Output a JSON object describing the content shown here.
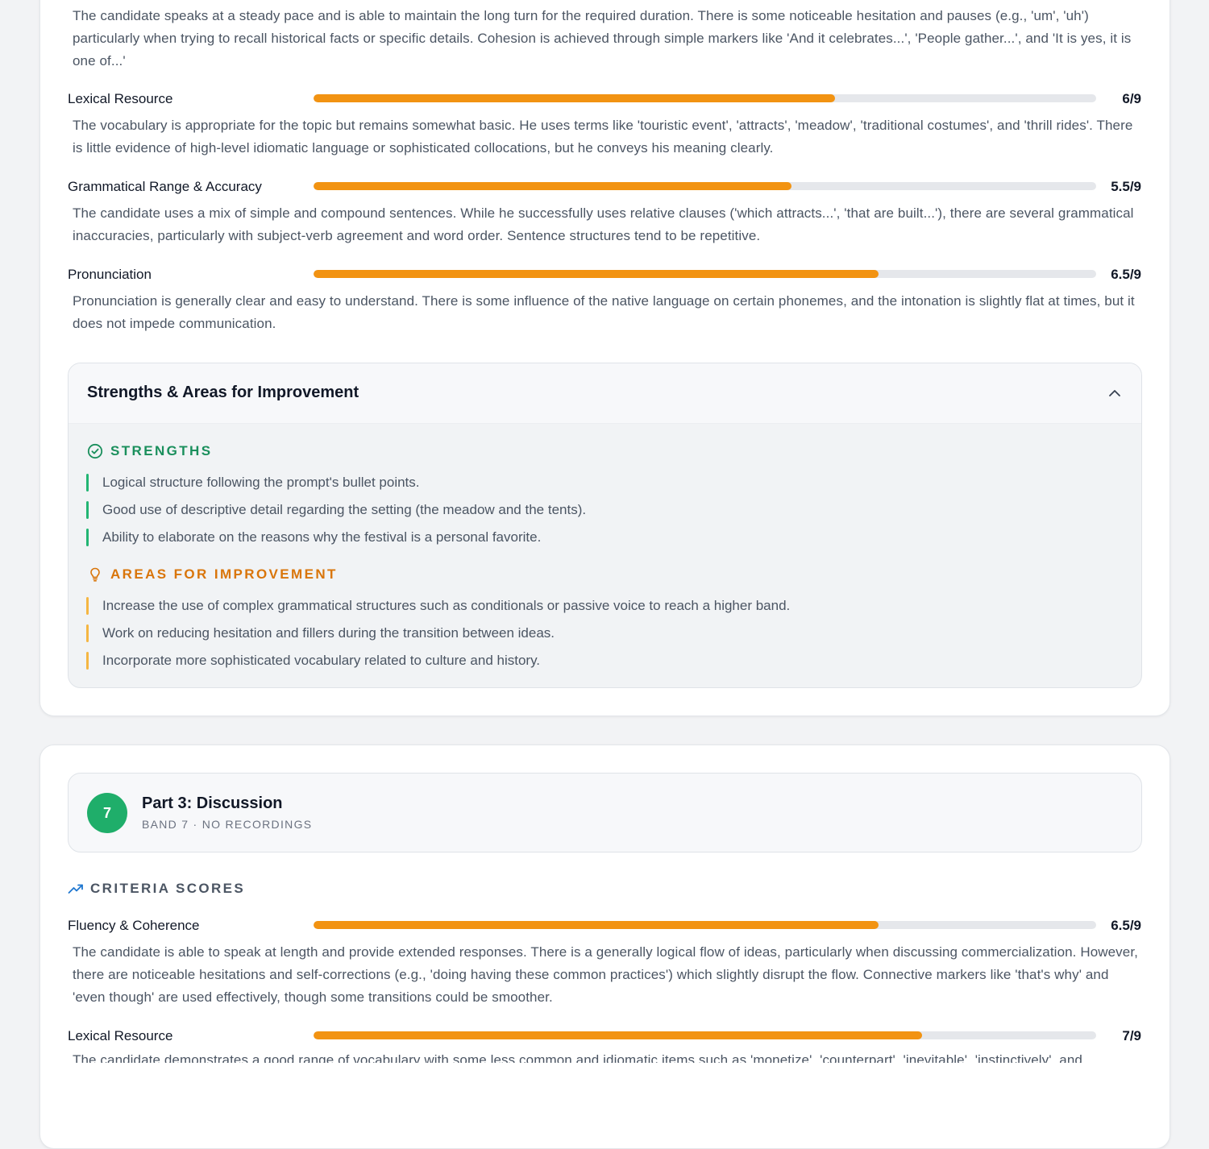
{
  "colors": {
    "accent_orange": "#f29312",
    "strength_green": "#1a8f5c",
    "improve_orange": "#d9750a",
    "band_green": "#1fae6a"
  },
  "part2": {
    "fluency_description": "The candidate speaks at a steady pace and is able to maintain the long turn for the required duration. There is some noticeable hesitation and pauses (e.g., 'um', 'uh') particularly when trying to recall historical facts or specific details. Cohesion is achieved through simple markers like 'And it celebrates...', 'People gather...', and 'It is yes, it is one of...'",
    "criteria": [
      {
        "label": "Lexical Resource",
        "score": "6/9",
        "value": 6,
        "max": 9,
        "description": "The vocabulary is appropriate for the topic but remains somewhat basic. He uses terms like 'touristic event', 'attracts', 'meadow', 'traditional costumes', and 'thrill rides'. There is little evidence of high-level idiomatic language or sophisticated collocations, but he conveys his meaning clearly."
      },
      {
        "label": "Grammatical Range & Accuracy",
        "score": "5.5/9",
        "value": 5.5,
        "max": 9,
        "description": "The candidate uses a mix of simple and compound sentences. While he successfully uses relative clauses ('which attracts...', 'that are built...'), there are several grammatical inaccuracies, particularly with subject-verb agreement and word order. Sentence structures tend to be repetitive."
      },
      {
        "label": "Pronunciation",
        "score": "6.5/9",
        "value": 6.5,
        "max": 9,
        "description": "Pronunciation is generally clear and easy to understand. There is some influence of the native language on certain phonemes, and the intonation is slightly flat at times, but it does not impede communication."
      }
    ],
    "feedback_panel": {
      "title": "Strengths & Areas for Improvement",
      "chevron_icon": "chevron-up-icon",
      "strengths_heading": "STRENGTHS",
      "strengths": [
        "Logical structure following the prompt's bullet points.",
        "Good use of descriptive detail regarding the setting (the meadow and the tents).",
        "Ability to elaborate on the reasons why the festival is a personal favorite."
      ],
      "improvements_heading": "AREAS FOR IMPROVEMENT",
      "improvements": [
        "Increase the use of complex grammatical structures such as conditionals or passive voice to reach a higher band.",
        "Work on reducing hesitation and fillers during the transition between ideas.",
        "Incorporate more sophisticated vocabulary related to culture and history."
      ]
    }
  },
  "part3": {
    "band_badge": "7",
    "title": "Part 3: Discussion",
    "subtitle": "BAND 7 · NO RECORDINGS",
    "criteria_heading": "CRITERIA SCORES",
    "criteria": [
      {
        "label": "Fluency & Coherence",
        "score": "6.5/9",
        "value": 6.5,
        "max": 9,
        "description": "The candidate is able to speak at length and provide extended responses. There is a generally logical flow of ideas, particularly when discussing commercialization. However, there are noticeable hesitations and self-corrections (e.g., 'doing having these common practices') which slightly disrupt the flow. Connective markers like 'that's why' and 'even though' are used effectively, though some transitions could be smoother."
      },
      {
        "label": "Lexical Resource",
        "score": "7/9",
        "value": 7,
        "max": 9,
        "description": "The candidate demonstrates a good range of vocabulary with some less common and idiomatic items such as 'monetize', 'counterpart', 'inevitable', 'instinctively', and"
      }
    ]
  }
}
